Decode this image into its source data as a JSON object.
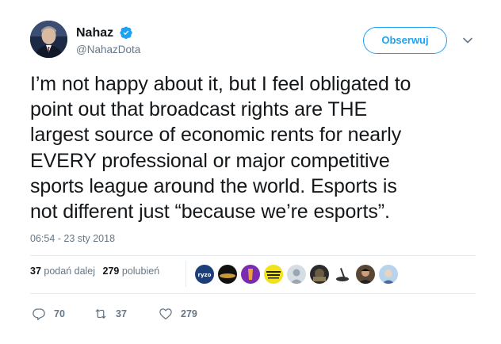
{
  "author": {
    "display_name": "Nahaz",
    "handle": "@NahazDota",
    "verified": true
  },
  "follow_button": {
    "label": "Obserwuj"
  },
  "tweet": {
    "lines": [
      "I’m not happy about it, but I feel obligated to",
      "point out that broadcast rights are THE",
      "largest source of economic rents for nearly",
      "EVERY professional or major competitive",
      "sports league around the world.  Esports is",
      "not different just “because we’re esports”."
    ],
    "timestamp": "06:54 - 23 sty 2018"
  },
  "stats": {
    "retweets_count": "37",
    "retweets_label": "podań dalej",
    "likes_count": "279",
    "likes_label": "polubień"
  },
  "likers": [
    {
      "icon": "liker-avatar-ryzo",
      "label": "ryzo"
    },
    {
      "icon": "liker-avatar-dark"
    },
    {
      "icon": "liker-avatar-purple"
    },
    {
      "icon": "liker-avatar-yellow-sticker"
    },
    {
      "icon": "liker-avatar-default"
    },
    {
      "icon": "liker-avatar-photo"
    },
    {
      "icon": "liker-avatar-joystick"
    },
    {
      "icon": "liker-avatar-person"
    },
    {
      "icon": "liker-avatar-blue"
    }
  ],
  "actions": {
    "replies": "70",
    "retweets": "37",
    "likes": "279"
  },
  "colors": {
    "accent": "#1da1f2",
    "secondary_text": "#657786",
    "divider": "#e6ecf0"
  }
}
